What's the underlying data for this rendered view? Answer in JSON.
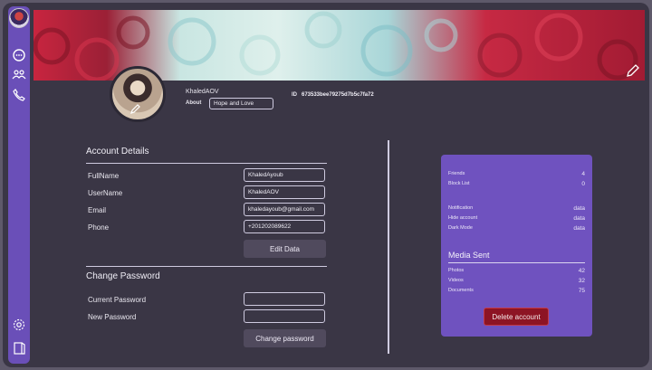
{
  "profile": {
    "username": "KhaledAOV",
    "about_label": "About",
    "about_value": "Hope and Love",
    "id_label": "ID",
    "id_value": "673533bee79275d7b5c7fa72"
  },
  "account": {
    "title": "Account Details",
    "fields": [
      {
        "label": "FullName",
        "value": "KhaledAyoub"
      },
      {
        "label": "UserName",
        "value": "KhaledAOV"
      },
      {
        "label": "Email",
        "value": "khaledayoub@gmail.com"
      },
      {
        "label": "Phone",
        "value": "+201202089622"
      }
    ],
    "edit_button": "Edit Data"
  },
  "password": {
    "title": "Change Password",
    "current_label": "Current Password",
    "new_label": "New Password",
    "current_value": "",
    "new_value": "",
    "button": "Change password"
  },
  "stats": {
    "friends_label": "Friends",
    "friends_value": "4",
    "blocklist_label": "Block List",
    "blocklist_value": "0",
    "notification_label": "Notification",
    "notification_value": "data",
    "hide_label": "Hide account",
    "hide_value": "data",
    "dark_label": "Dark Mode",
    "dark_value": "data"
  },
  "media": {
    "title": "Media Sent",
    "photos_label": "Photos",
    "photos_value": "42",
    "videos_label": "Videos",
    "videos_value": "32",
    "documents_label": "Documents",
    "documents_value": "75"
  },
  "delete_button": "Delete account",
  "sidebar": {
    "icons": [
      "app-logo-icon",
      "chat-icon",
      "group-icon",
      "call-icon",
      "settings-icon",
      "logout-icon"
    ]
  },
  "colors": {
    "background": "#3a3645",
    "sidebar": "#6a4fb8",
    "card": "#6f52bf",
    "danger": "#8d1424"
  }
}
